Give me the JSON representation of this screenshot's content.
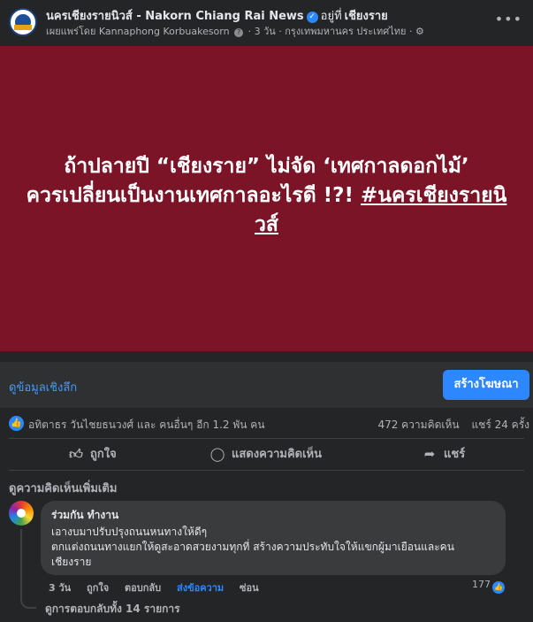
{
  "header": {
    "page_name": "นครเชียงรายนิวส์ - Nakorn Chiang Rai News",
    "verified_icon": "verified-badge",
    "location_prefix": "อยู่ที่",
    "location": "เชียงราย",
    "published_by": "เผยแพร่โดย Kannaphong Korbuakesorn",
    "time_and_place": "· 3 วัน · กรุงเทพมหานคร ประเทศไทย ·",
    "more_icon": "more-horizontal-icon"
  },
  "image": {
    "background_color": "#7a1426",
    "headline_part1": "ถ้าปลายปี “เชียงราย” ไม่จัด ‘เทศกาลดอกไม้’",
    "headline_part2": "ควรเปลี่ยนเป็นงานเทศกาลอะไรดี !?!",
    "hashtag": "#นครเชียงรายนิวส์"
  },
  "link_row": {
    "link_text": "ดูข้อมูลเชิงลึก",
    "ad_button_label": "สร้างโฆษณา"
  },
  "stats": {
    "reactions_text": "อทิตาธร วันไชยธนวงศ์ และ คนอื่นๆ อีก 1.2 พัน คน",
    "comments_count": "472 ความคิดเห็น",
    "shares_count": "แชร์ 24 ครั้ง"
  },
  "actions": {
    "like_label": "ถูกใจ",
    "comment_label": "แสดงความคิดเห็น",
    "share_label": "แชร์"
  },
  "comments_section": {
    "more_comments_label": "ดูความคิดเห็นเพิ่มเติม",
    "comment": {
      "author": "ร่วมกัน ทำงาน",
      "line1": "เอางบมาปรับปรุงถนนหนทางให้ดีๆ",
      "line2": "ตกแต่งถนนทางแยกให้ดูสะอาดสวยงามทุกที่ สร้างความประทับใจให้แขกผู้มาเยือนและคน",
      "line3": "เชียงราย",
      "time": "3 วัน",
      "like": "ถูกใจ",
      "reply": "ตอบกลับ",
      "send_message": "ส่งข้อความ",
      "hide": "ซ่อน",
      "like_count": "177"
    },
    "view_replies": "ดูการตอบกลับทั้ง 14 รายการ"
  },
  "colors": {
    "background": "#242526",
    "accent": "#2d88ff",
    "link": "#4599ff"
  }
}
